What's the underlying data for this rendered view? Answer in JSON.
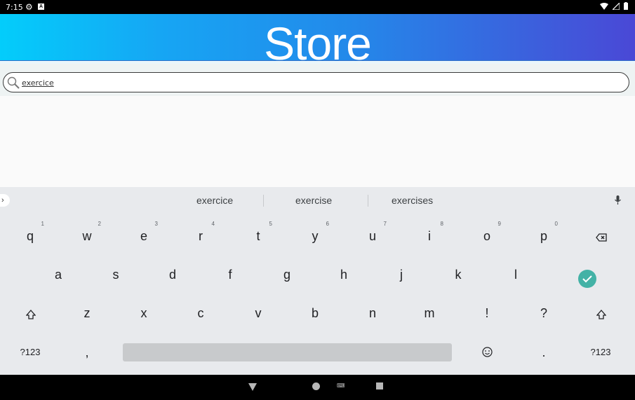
{
  "status_bar": {
    "time": "7:15",
    "settings_icon": "gear-icon",
    "notification_icon": "a-icon",
    "wifi_icon": "wifi-icon",
    "signal_icon": "signal-icon",
    "battery_icon": "battery-icon"
  },
  "header": {
    "title": "Store"
  },
  "search": {
    "query": "exercice",
    "icon": "search-icon"
  },
  "suggestions": {
    "items": [
      "exercice",
      "exercise",
      "exercises"
    ],
    "expand_icon": "chevron-right-icon",
    "mic_icon": "mic-icon"
  },
  "keyboard": {
    "row1": [
      {
        "label": "q",
        "hint": "1"
      },
      {
        "label": "w",
        "hint": "2"
      },
      {
        "label": "e",
        "hint": "3"
      },
      {
        "label": "r",
        "hint": "4"
      },
      {
        "label": "t",
        "hint": "5"
      },
      {
        "label": "y",
        "hint": "6"
      },
      {
        "label": "u",
        "hint": "7"
      },
      {
        "label": "i",
        "hint": "8"
      },
      {
        "label": "o",
        "hint": "9"
      },
      {
        "label": "p",
        "hint": "0"
      }
    ],
    "row2": [
      "a",
      "s",
      "d",
      "f",
      "g",
      "h",
      "j",
      "k",
      "l"
    ],
    "row3": [
      "z",
      "x",
      "c",
      "v",
      "b",
      "n",
      "m",
      "!",
      "?"
    ],
    "symbols_label": "?123",
    "comma_label": ",",
    "period_label": ".",
    "backspace_icon": "backspace-icon",
    "enter_icon": "check-icon",
    "shift_icon": "shift-icon",
    "emoji_icon": "emoji-icon",
    "enter_color": "#43b2a6"
  },
  "nav_bar": {
    "back_icon": "back-icon",
    "home_icon": "home-icon",
    "keyboard_icon": "keyboard-switch-icon",
    "recents_icon": "recents-icon"
  }
}
